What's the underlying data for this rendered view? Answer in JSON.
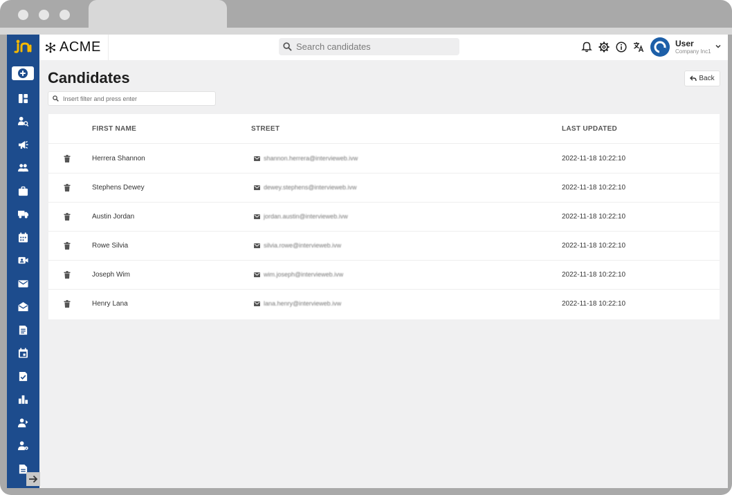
{
  "colors": {
    "sidebar": "#1d4c8d",
    "accent_logo": "#f5b800",
    "page_bg": "#f0f0f1",
    "avatar": "#1d5fa8"
  },
  "header": {
    "brand": "ACME",
    "search_placeholder": "Search candidates",
    "user": {
      "name": "User",
      "company": "Company Inc1"
    },
    "icons": [
      "bell-icon",
      "gear-icon",
      "info-icon",
      "translate-icon"
    ]
  },
  "sidebar": {
    "items": [
      "dashboard-icon",
      "candidate-search-icon",
      "megaphone-icon",
      "people-icon",
      "briefcase-icon",
      "truck-icon",
      "calendar-grid-icon",
      "video-icon",
      "mail-icon",
      "drafts-icon",
      "document-icon",
      "event-icon",
      "task-icon",
      "chart-icon",
      "user-manage-icon",
      "user-settings-icon",
      "file-icon"
    ]
  },
  "page": {
    "title": "Candidates",
    "filter_placeholder": "Insert filter and press enter",
    "back_label": "Back"
  },
  "table": {
    "columns": [
      "FIRST NAME",
      "STREET",
      "LAST UPDATED"
    ],
    "rows": [
      {
        "name": "Herrera Shannon",
        "email": "shannon.herrera@intervieweb.ivw",
        "updated": "2022-11-18 10:22:10"
      },
      {
        "name": "Stephens Dewey",
        "email": "dewey.stephens@intervieweb.ivw",
        "updated": "2022-11-18 10:22:10"
      },
      {
        "name": "Austin Jordan",
        "email": "jordan.austin@intervieweb.ivw",
        "updated": "2022-11-18 10:22:10"
      },
      {
        "name": "Rowe Silvia",
        "email": "silvia.rowe@intervieweb.ivw",
        "updated": "2022-11-18 10:22:10"
      },
      {
        "name": "Joseph Wim",
        "email": "wim.joseph@intervieweb.ivw",
        "updated": "2022-11-18 10:22:10"
      },
      {
        "name": "Henry Lana",
        "email": "lana.henry@intervieweb.ivw",
        "updated": "2022-11-18 10:22:10"
      }
    ]
  }
}
